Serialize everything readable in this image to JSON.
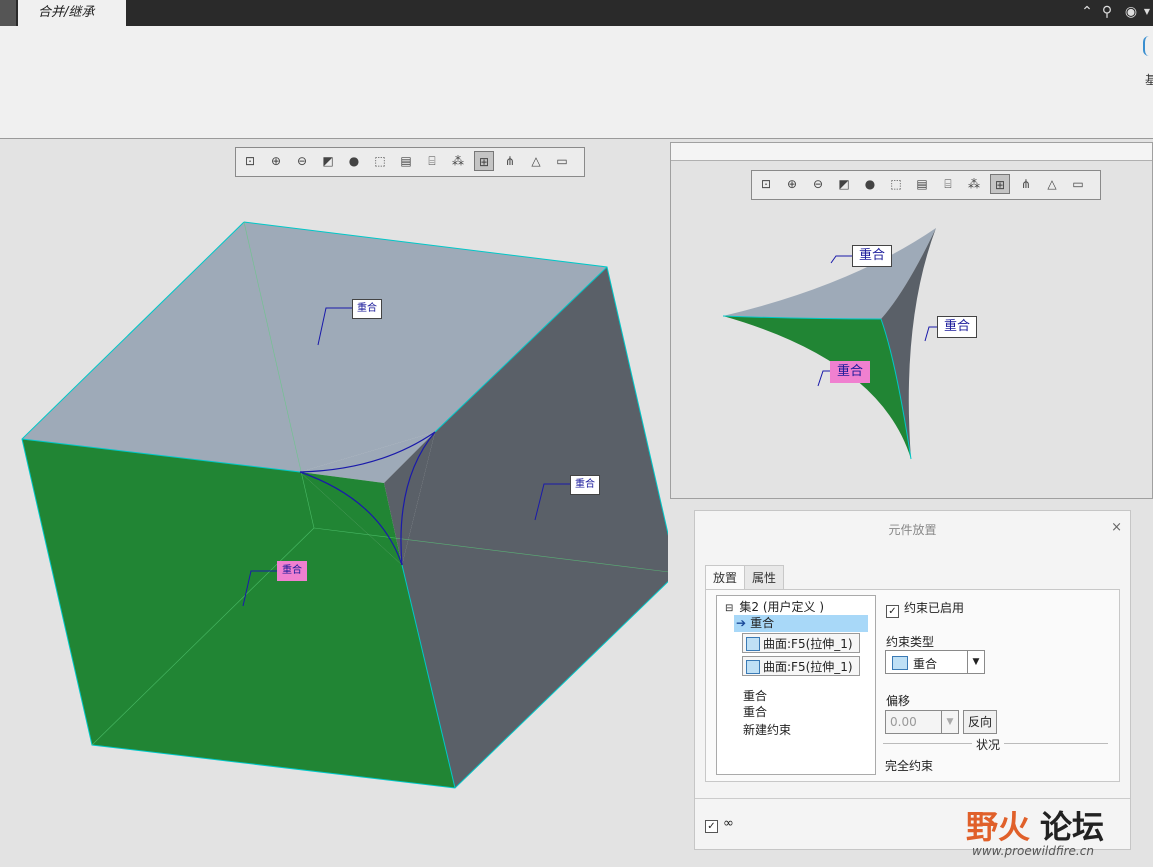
{
  "tab_title": "合并/继承",
  "ribbon_cut_label": "基",
  "main_tags": {
    "top": "重合",
    "right": "重合",
    "left": "重合"
  },
  "preview_tags": {
    "top": "重合",
    "right": "重合",
    "left": "重合"
  },
  "toolbar_icons": [
    "zoom-fit-icon",
    "zoom-in-icon",
    "zoom-out-icon",
    "repaint-icon",
    "display-style-icon",
    "saved-orientation-icon",
    "view-manager-icon",
    "datum-display-icon",
    "annotation-display-icon",
    "spin-center-icon",
    "csys-icon",
    "perspective-icon",
    "render-icon"
  ],
  "dialog": {
    "title": "元件放置",
    "close": "×",
    "tabs": [
      "放置",
      "属性"
    ],
    "tree": {
      "set_label": "集2 (用户定义 )",
      "active_constraint": "重合",
      "refs": [
        "曲面:F5(拉伸_1)",
        "曲面:F5(拉伸_1)"
      ],
      "other_constraints": [
        "重合",
        "重合"
      ],
      "new_constraint": "新建约束"
    },
    "constraint_enabled_label": "约束已启用",
    "constraint_type_label": "约束类型",
    "constraint_type_value": "重合",
    "offset_label": "偏移",
    "offset_value": "0.00",
    "flip_button": "反向",
    "status_label": "状况",
    "status_value": "完全约束"
  },
  "watermark": {
    "text1": "野火",
    "text2": "论坛",
    "url": "www.proewildfire.cn"
  },
  "colors": {
    "green_face": "#218534",
    "gray_face": "#9eaab8",
    "dark_face": "#5a6068",
    "edge": "#00c8c8",
    "curve": "#1a1aaa"
  }
}
